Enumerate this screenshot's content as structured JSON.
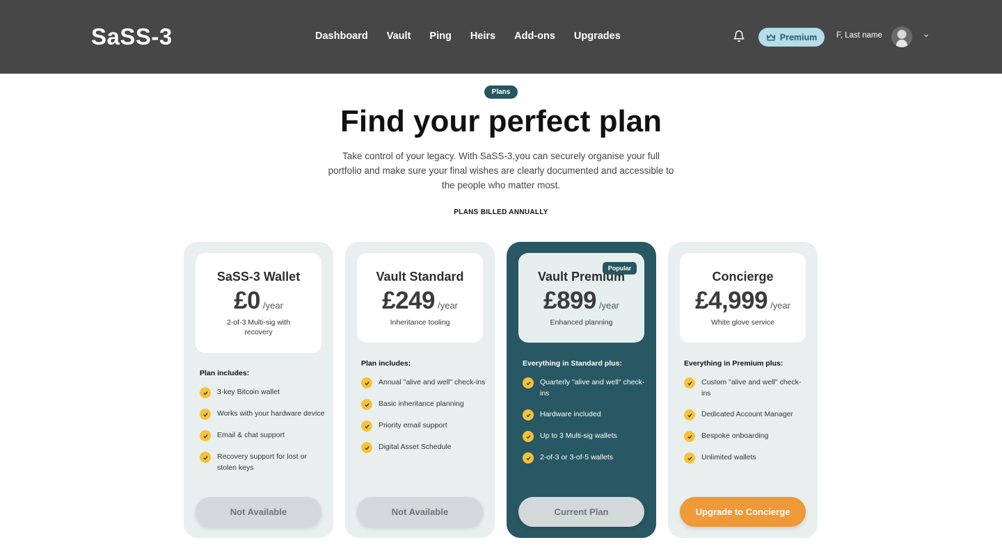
{
  "header": {
    "logo": "SaSS-3",
    "nav": [
      "Dashboard",
      "Vault",
      "Ping",
      "Heirs",
      "Add-ons",
      "Upgrades"
    ],
    "premium_label": "Premium",
    "username": "F, Last name"
  },
  "hero": {
    "tag": "Plans",
    "title": "Find your perfect plan",
    "subtitle": "Take control of your legacy. With SaSS-3,you can securely organise your full portfolio and make sure your final wishes are clearly documented and accessible to the people who matter most.",
    "billing_note": "PLANS BILLED ANNUALLY"
  },
  "plans": [
    {
      "name": "SaSS-3 Wallet",
      "price": "£0",
      "period": "/year",
      "description": "2-of-3 Multi-sig with recovery",
      "includes_label": "Plan includes:",
      "features": [
        "3-key Bitcoin wallet",
        "Works with your hardware device",
        "Email & chat support",
        "Recovery support for lost or stolen keys"
      ],
      "cta": "Not Available"
    },
    {
      "name": "Vault Standard",
      "price": "£249",
      "period": "/year",
      "description": "Inheritance tooling",
      "includes_label": "Plan includes:",
      "features": [
        "Annual \"alive and well\" check-ins",
        "Basic inheritance planning",
        "Priority email support",
        "Digital Asset Schedule"
      ],
      "cta": "Not Available"
    },
    {
      "name": "Vault Premium",
      "price": "£899",
      "period": "/year",
      "description": "Enhanced planning",
      "badge": "Popular",
      "includes_label": "Everything in Standard plus:",
      "features": [
        "Quarterly \"alive and well\" check-ins",
        "Hardware included",
        "Up to 3 Multi-sig wallets",
        "2-of-3 or 3-of-5 wallets"
      ],
      "cta": "Current Plan"
    },
    {
      "name": "Concierge",
      "price": "£4,999",
      "period": "/year",
      "description": "White glove service",
      "includes_label": "Everything in Premium plus:",
      "features": [
        "Custom \"alive and well\" check-ins",
        "Dedicated Account Manager",
        "Bespoke onboarding",
        "Unlimited wallets"
      ],
      "cta": "Upgrade to Concierge"
    }
  ],
  "colors": {
    "header_bg": "#474747",
    "accent_teal": "#285863",
    "card_bg": "#e8efee",
    "check_yellow": "#f5c23b",
    "upgrade_orange": "#ee9a38",
    "premium_pill": "#b3dde8"
  }
}
